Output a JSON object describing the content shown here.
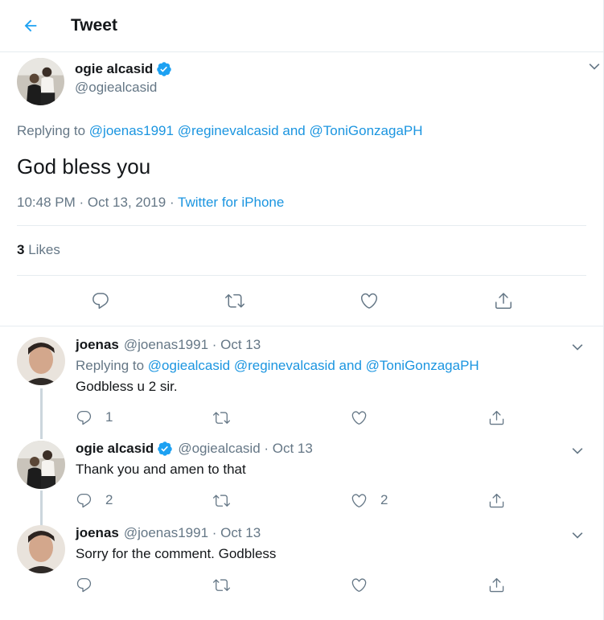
{
  "header": {
    "title": "Tweet"
  },
  "main_tweet": {
    "author_name": "ogie alcasid",
    "author_handle": "@ogiealcasid",
    "replying_prefix": "Replying to",
    "replying_to": [
      "@joenas1991",
      "@reginevalcasid"
    ],
    "replying_and": "and",
    "replying_last": "@ToniGonzagaPH",
    "text": "God bless you",
    "time": "10:48 PM · Oct 13, 2019 ·",
    "source": "Twitter for iPhone",
    "likes_count": "3",
    "likes_label": "Likes"
  },
  "replies": [
    {
      "name": "joenas",
      "meta": "@joenas1991 · Oct 13",
      "replying_prefix": "Replying to",
      "replying_to": [
        "@ogiealcasid",
        "@reginevalcasid"
      ],
      "replying_and": "and",
      "replying_last": "@ToniGonzagaPH",
      "text": "Godbless u 2 sir.",
      "reply_count": "1",
      "retweet_count": "",
      "like_count": ""
    },
    {
      "name": "ogie alcasid",
      "meta": "@ogiealcasid · Oct 13",
      "text": "Thank you and amen to that",
      "reply_count": "2",
      "retweet_count": "",
      "like_count": "2"
    },
    {
      "name": "joenas",
      "meta": "@joenas1991 · Oct 13",
      "text": "Sorry for the comment.  Godbless",
      "reply_count": "",
      "retweet_count": "",
      "like_count": ""
    }
  ],
  "colors": {
    "accent": "#1da1f2",
    "link": "#1b95e0",
    "muted": "#657786",
    "border": "#e6ecf0"
  },
  "icons": [
    "back-arrow-icon",
    "verified-icon",
    "chevron-down-icon",
    "reply-icon",
    "retweet-icon",
    "like-icon",
    "share-icon"
  ]
}
